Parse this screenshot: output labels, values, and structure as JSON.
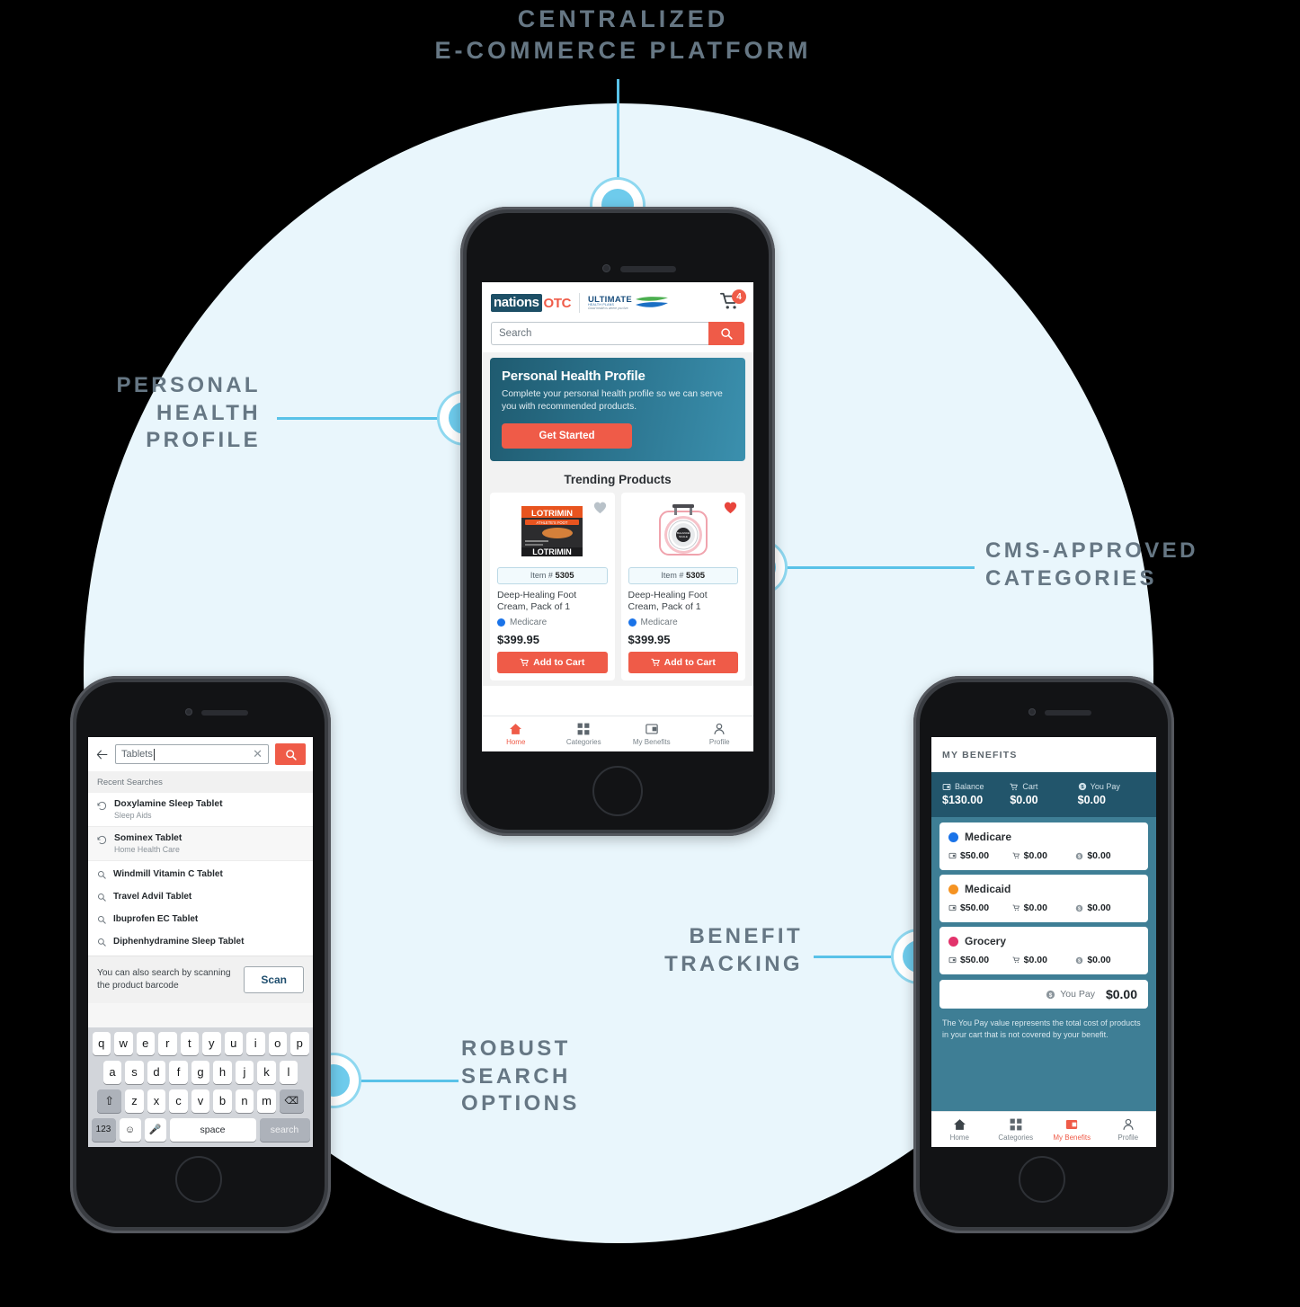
{
  "callouts": {
    "platform": "CENTRALIZED\nE-COMMERCE PLATFORM",
    "personal_health_profile": "PERSONAL\nHEALTH\nPROFILE",
    "cms_categories": "CMS-APPROVED\nCATEGORIES",
    "benefit_tracking": "BENEFIT\nTRACKING",
    "robust_search": "ROBUST\nSEARCH\nOPTIONS"
  },
  "colors": {
    "accent_coral": "#ef5b48",
    "marker_blue": "#6ecbec",
    "background_circle": "#e9f6fc",
    "callout_text": "#667784",
    "benefit_teal": "#3e7e95",
    "benefit_teal_dark": "#22556b",
    "medicare_dot": "#1a73e8",
    "medicaid_dot": "#f59322",
    "grocery_dot": "#e2336b"
  },
  "home_screen": {
    "logo": {
      "nations": "nations",
      "otc": "OTC",
      "partner_line1": "ULTIMATE",
      "partner_line2": "HEALTH PLANS",
      "partner_tagline": "Good health is where you live."
    },
    "cart": {
      "icon": "cart-icon",
      "badge": "4"
    },
    "search": {
      "placeholder": "Search",
      "value": "",
      "button_icon": "search-icon"
    },
    "php_banner": {
      "title": "Personal Health Profile",
      "body": "Complete your personal health profile so we can serve you with recommended products.",
      "cta": "Get Started"
    },
    "trending": {
      "heading": "Trending Products",
      "products": [
        {
          "image": "lotrimin-box-image",
          "favorite": false,
          "favorite_icon": "heart-icon",
          "item_label": "Item #",
          "item_number": "5305",
          "name": "Deep-Healing Foot Cream, Pack of 1",
          "plan": "Medicare",
          "plan_color": "#1a73e8",
          "price": "$399.95",
          "add_to_cart": "Add to Cart"
        },
        {
          "image": "scale-image",
          "favorite": true,
          "favorite_icon": "heart-icon",
          "item_label": "Item #",
          "item_number": "5305",
          "name": "Deep-Healing Foot Cream, Pack of 1",
          "plan": "Medicare",
          "plan_color": "#1a73e8",
          "price": "$399.95",
          "add_to_cart": "Add to Cart"
        }
      ]
    },
    "tabbar": [
      {
        "label": "Home",
        "icon": "home-icon",
        "active": true
      },
      {
        "label": "Categories",
        "icon": "grid-icon",
        "active": false
      },
      {
        "label": "My Benefits",
        "icon": "wallet-icon",
        "active": false
      },
      {
        "label": "Profile",
        "icon": "person-icon",
        "active": false
      }
    ]
  },
  "search_screen": {
    "back_icon": "back-arrow-icon",
    "input_value": "Tablets",
    "clear_icon": "close-icon",
    "search_icon": "search-icon",
    "recent_heading": "Recent Searches",
    "recent": [
      {
        "icon": "history-icon",
        "title": "Doxylamine Sleep Tablet",
        "category": "Sleep Aids"
      },
      {
        "icon": "history-icon",
        "title": "Sominex Tablet",
        "category": "Home Health Care"
      }
    ],
    "suggestions": [
      {
        "icon": "search-icon",
        "title": "Windmill Vitamin C Tablet"
      },
      {
        "icon": "search-icon",
        "title": "Travel Advil Tablet"
      },
      {
        "icon": "search-icon",
        "title": "Ibuprofen EC Tablet"
      },
      {
        "icon": "search-icon",
        "title": "Diphenhydramine Sleep Tablet"
      }
    ],
    "scan_text": "You can also search by scanning the product barcode",
    "scan_button": "Scan",
    "keyboard": {
      "row1": [
        "q",
        "w",
        "e",
        "r",
        "t",
        "y",
        "u",
        "i",
        "o",
        "p"
      ],
      "row2": [
        "a",
        "s",
        "d",
        "f",
        "g",
        "h",
        "j",
        "k",
        "l"
      ],
      "row3": [
        "z",
        "x",
        "c",
        "v",
        "b",
        "n",
        "m"
      ],
      "shift_icon": "shift-icon",
      "backspace_icon": "backspace-icon",
      "numbers_key": "123",
      "emoji_icon": "emoji-icon",
      "mic_icon": "microphone-icon",
      "space_key": "space",
      "search_key": "search"
    }
  },
  "benefits_screen": {
    "title": "MY BENEFITS",
    "summary": [
      {
        "icon": "card-icon",
        "label": "Balance",
        "value": "$130.00"
      },
      {
        "icon": "cart-icon",
        "label": "Cart",
        "value": "$0.00"
      },
      {
        "icon": "dollar-icon",
        "label": "You Pay",
        "value": "$0.00"
      }
    ],
    "benefits": [
      {
        "name": "Medicare",
        "color": "#1a73e8",
        "balance": "$50.00",
        "cart": "$0.00",
        "you_pay": "$0.00"
      },
      {
        "name": "Medicaid",
        "color": "#f59322",
        "balance": "$50.00",
        "cart": "$0.00",
        "you_pay": "$0.00"
      },
      {
        "name": "Grocery",
        "color": "#e2336b",
        "balance": "$50.00",
        "cart": "$0.00",
        "you_pay": "$0.00"
      }
    ],
    "you_pay_label": "You Pay",
    "you_pay_value": "$0.00",
    "note": "The You Pay value represents the total cost of products in your cart that is not covered by your benefit.",
    "tabbar": [
      {
        "label": "Home",
        "icon": "home-icon",
        "active": false
      },
      {
        "label": "Categories",
        "icon": "grid-icon",
        "active": false
      },
      {
        "label": "My Benefits",
        "icon": "wallet-icon",
        "active": true
      },
      {
        "label": "Profile",
        "icon": "person-icon",
        "active": false
      }
    ]
  }
}
